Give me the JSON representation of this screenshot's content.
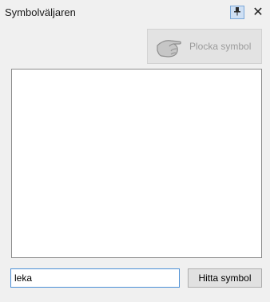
{
  "panel": {
    "title": "Symbolväljaren",
    "pin_icon": "pin-icon",
    "close_label": "✕"
  },
  "pick": {
    "label": "Plocka symbol",
    "icon": "hand-pointer-icon",
    "state": "disabled"
  },
  "search": {
    "value": "leka",
    "button_label": "Hitta symbol"
  },
  "colors": {
    "panel_bg": "#f0f0f0",
    "pin_bg": "#cfe0f4",
    "input_border": "#4b8fd6"
  }
}
